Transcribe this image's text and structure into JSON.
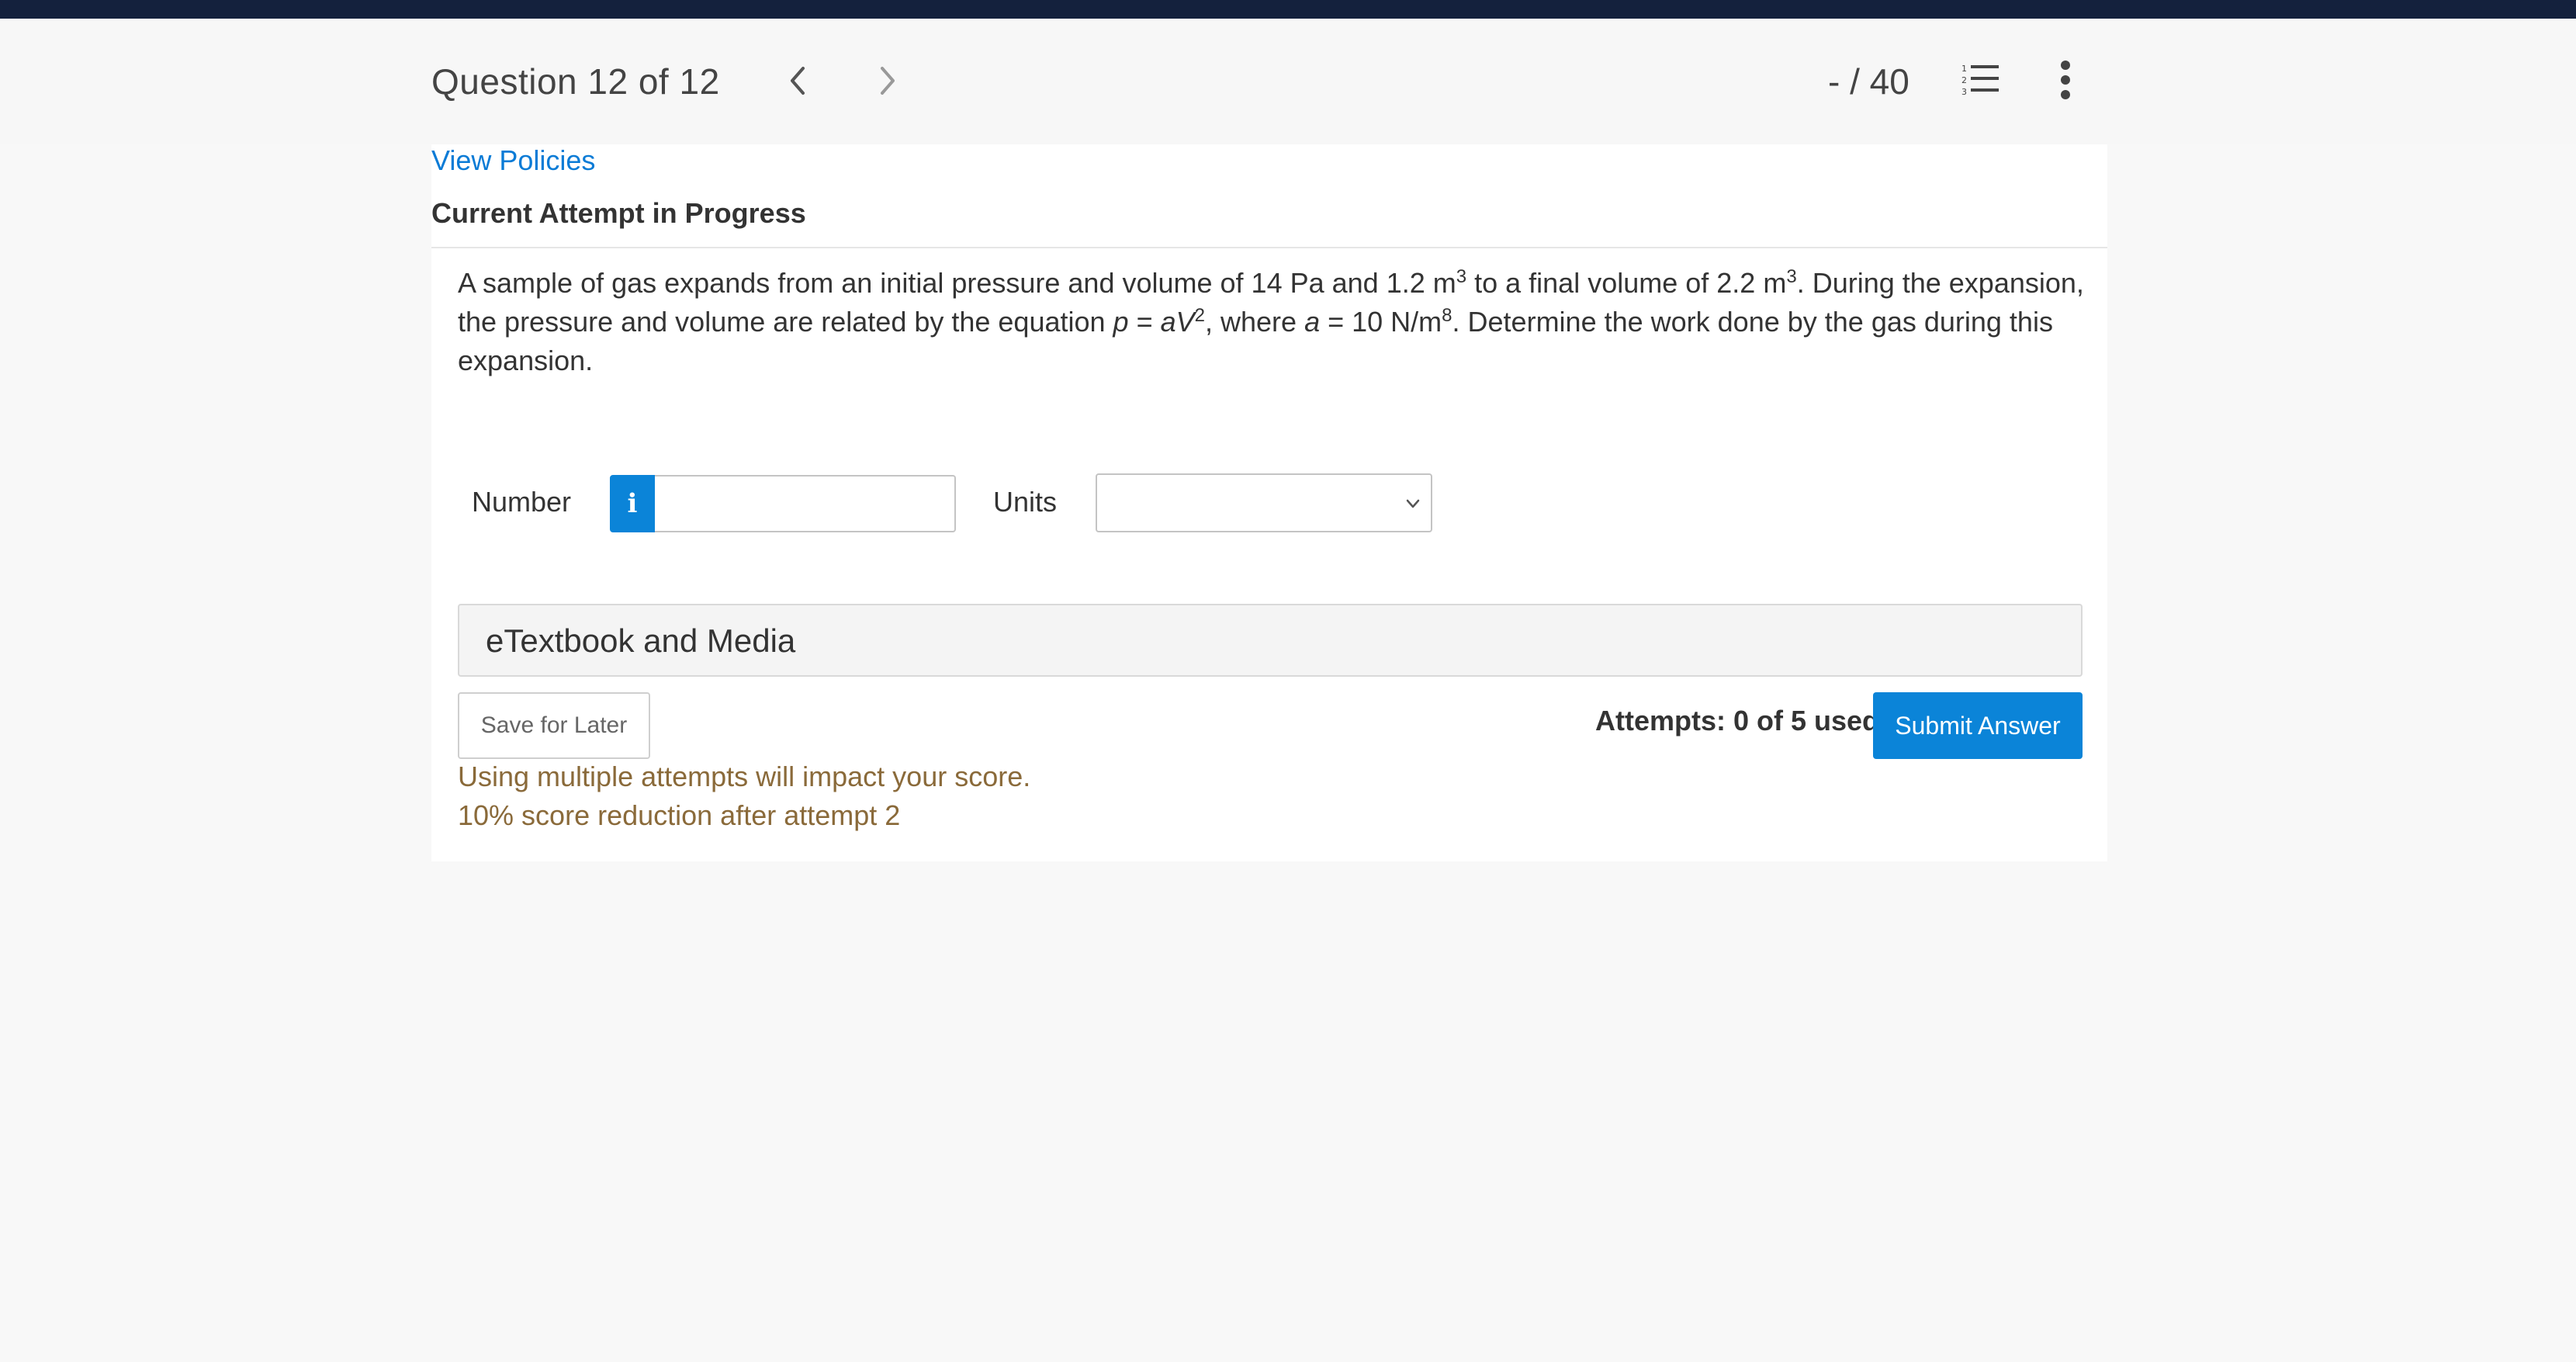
{
  "header": {
    "question_title": "Question 12 of 12",
    "score": "- / 40",
    "icons": [
      "chevron-left-icon",
      "chevron-right-icon",
      "numbered-list-icon",
      "more-vertical-icon"
    ]
  },
  "policies_link": "View Policies",
  "attempt_heading": "Current Attempt in Progress",
  "question": {
    "p1": "A sample of gas expands from an initial pressure and volume of 14 Pa and 1.2 m",
    "sup1": "3",
    "p2": " to a final volume of 2.2 m",
    "sup2": "3",
    "p3": ". During the expansion, the pressure and volume are related by the equation ",
    "var_p": "p",
    "eq": " = ",
    "var_aV": "aV",
    "sup3": "2",
    "p4": ", where ",
    "var_a": "a",
    "p5": " = 10 N/m",
    "sup4": "8",
    "p6": ". Determine the work done by the gas during this expansion."
  },
  "answer": {
    "number_label": "Number",
    "info_icon_glyph": "i",
    "number_value": "",
    "units_label": "Units",
    "units_value": ""
  },
  "etextbook_label": "eTextbook and Media",
  "save_label": "Save for Later",
  "attempts_text": "Attempts: 0 of 5 used",
  "submit_label": "Submit Answer",
  "warning_line1": "Using multiple attempts will impact your score.",
  "warning_line2": "10% score reduction after attempt 2",
  "colors": {
    "top_bar": "#14213d",
    "accent": "#0b84d8",
    "warning": "#8a6a3a"
  }
}
